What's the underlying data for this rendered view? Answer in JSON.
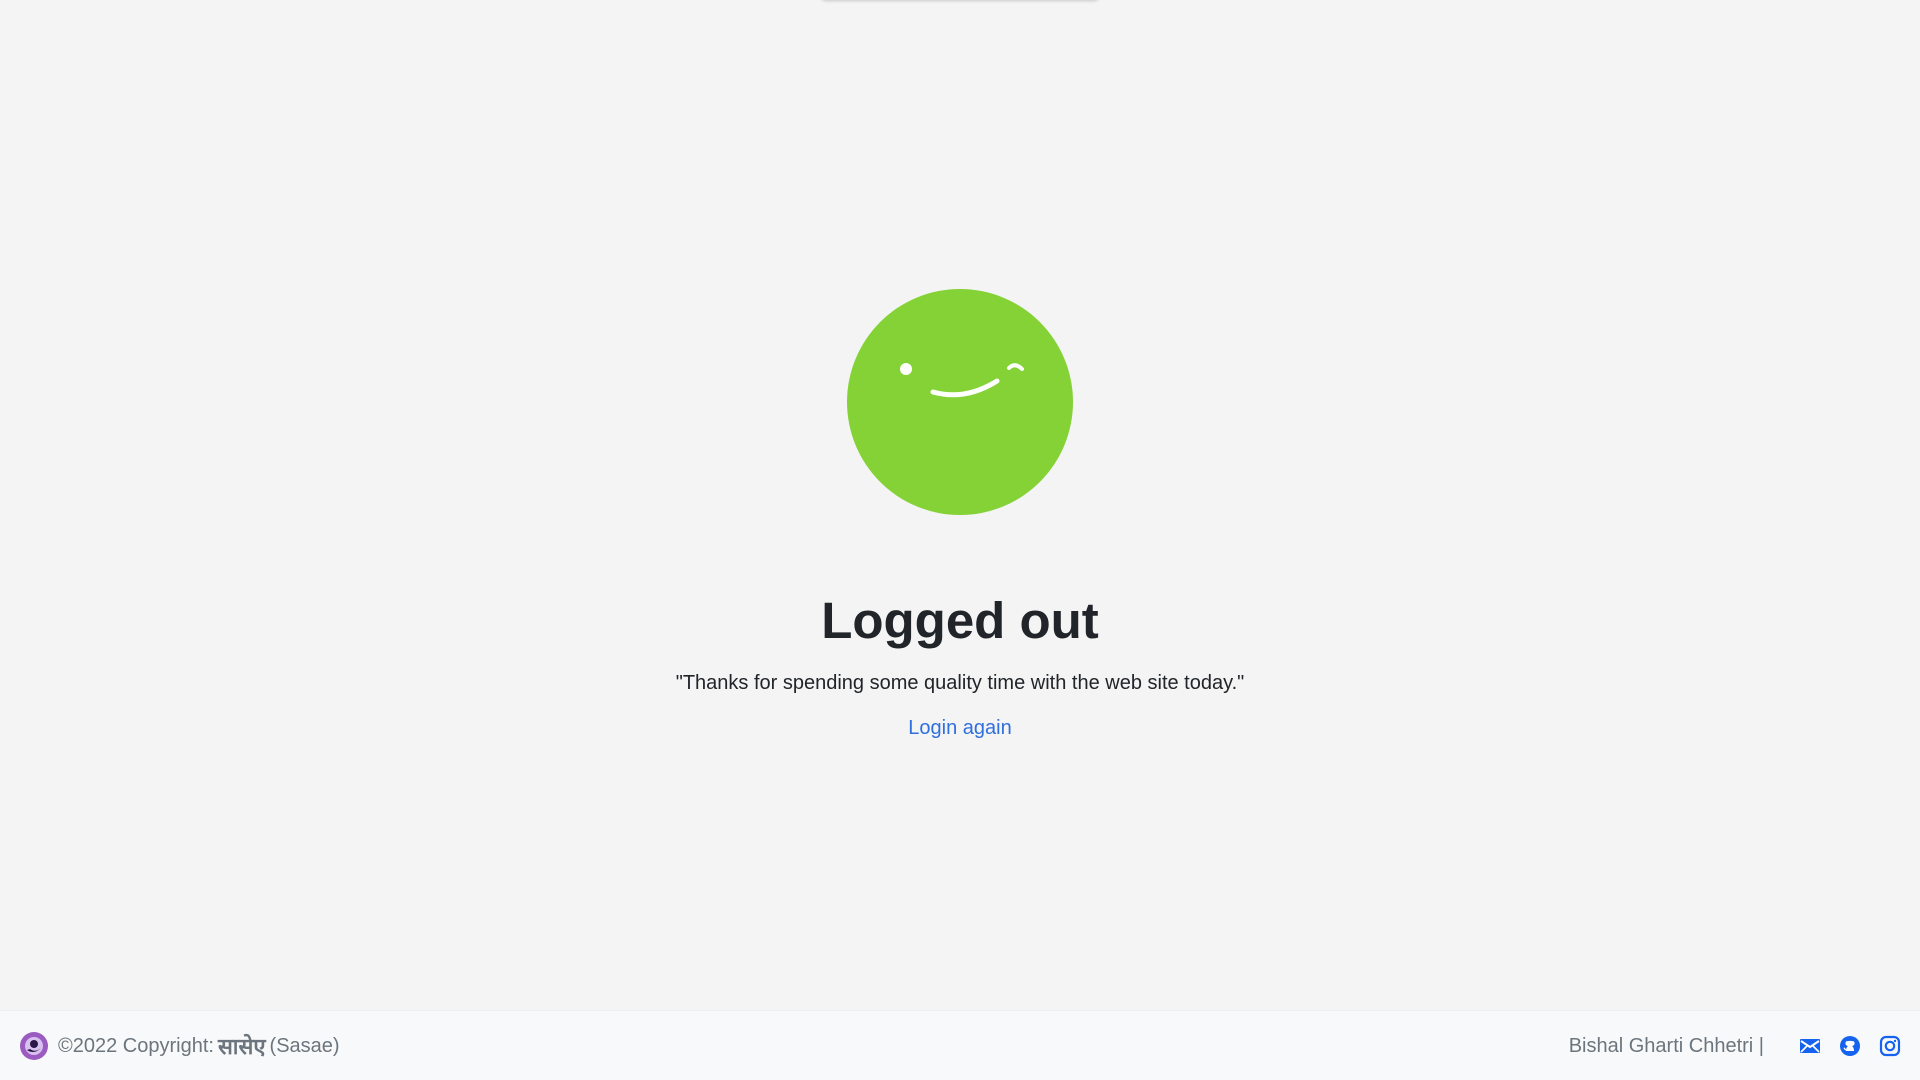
{
  "main": {
    "title": "Logged out",
    "quote": "\"Thanks for spending some quality time with the web site today.\"",
    "login_link": "Login again"
  },
  "footer": {
    "copyright": "©2022 Copyright:",
    "brand_name": "सासेए",
    "brand_sub": "(Sasae)",
    "author": "Bishal Gharti Chhetri |",
    "icons": [
      "envelope-icon",
      "github-icon",
      "instagram-icon"
    ]
  },
  "colors": {
    "face": "#84d236",
    "link": "#2f6fde",
    "icon": "#1563ee",
    "logo": "#9b5cc2"
  }
}
